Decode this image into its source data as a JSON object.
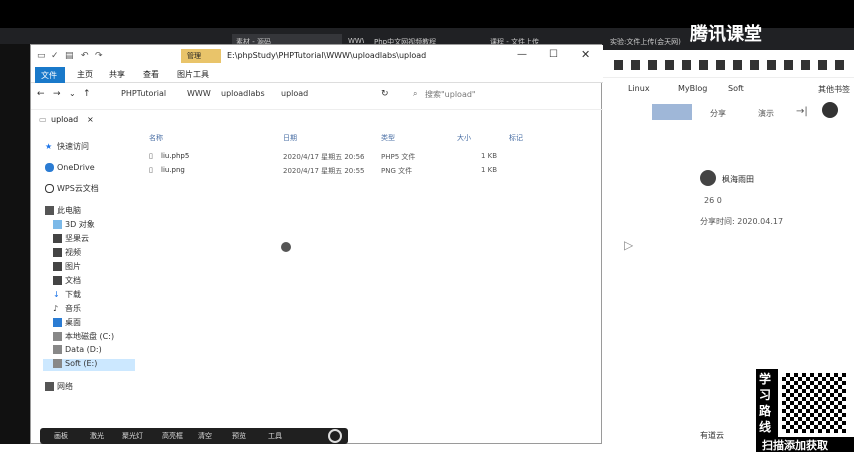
{
  "brand": {
    "text": "腾讯课堂"
  },
  "browser": {
    "tabs": [
      "素材 - 源码",
      "WWW",
      "Php中文网视频教程",
      "课程 - 文件上传",
      "实验:文件上传(会天网)"
    ],
    "bookmarks": [
      "Linux",
      "MyBlog",
      "Soft",
      "其他书签"
    ],
    "right_panel": {
      "buttons": [
        "分享",
        "演示"
      ],
      "username": "枫海雨田",
      "stats": "26   0",
      "time": "分享时间: 2020.04.17",
      "footer": "有道云"
    }
  },
  "explorer": {
    "title": "E:\\phpStudy\\PHPTutorial\\WWW\\uploadlabs\\upload",
    "manage_label": "管理",
    "ribbon_tabs": [
      "文件",
      "主页",
      "共享",
      "查看",
      "图片工具"
    ],
    "breadcrumb": [
      "PHPTutorial",
      "WWW",
      "uploadlabs",
      "upload"
    ],
    "search_placeholder": "搜索\"upload\"",
    "tab_label": "upload",
    "nav": [
      {
        "label": "快速访问"
      },
      {
        "label": "OneDrive"
      },
      {
        "label": "WPS云文档"
      },
      {
        "label": "此电脑"
      },
      {
        "label": "3D 对象"
      },
      {
        "label": "坚果云"
      },
      {
        "label": "视频"
      },
      {
        "label": "图片"
      },
      {
        "label": "文档"
      },
      {
        "label": "下载"
      },
      {
        "label": "音乐"
      },
      {
        "label": "桌面"
      },
      {
        "label": "本地磁盘 (C:)"
      },
      {
        "label": "Data (D:)"
      },
      {
        "label": "Soft (E:)"
      },
      {
        "label": "网络"
      }
    ],
    "columns": [
      "名称",
      "日期",
      "类型",
      "大小",
      "标记"
    ],
    "files": [
      {
        "name": "liu.php5",
        "date": "2020/4/17 星期五 20:56",
        "type": "PHP5 文件",
        "size": "1 KB"
      },
      {
        "name": "liu.png",
        "date": "2020/4/17 星期五 20:55",
        "type": "PNG 文件",
        "size": "1 KB"
      }
    ]
  },
  "bottom_toolbar": [
    "画板",
    "激光",
    "聚光灯",
    "高亮框",
    "清空",
    "预览",
    "工具"
  ],
  "qr": {
    "text": "学习路线",
    "caption": "扫描添加获取"
  }
}
